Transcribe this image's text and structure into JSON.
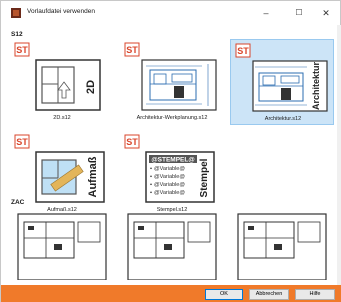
{
  "window": {
    "title": "Vorlaufdatei verwenden",
    "min_label": "–",
    "max_label": "☐",
    "close_label": "✕"
  },
  "groups": [
    {
      "label": "S12",
      "tiles": [
        {
          "label": "2D.s12",
          "badge": "ST",
          "side_text": "2D",
          "selected": false
        },
        {
          "label": "Architektur-Werkplanung.s12",
          "badge": "ST",
          "side_text": "",
          "selected": false
        },
        {
          "label": "Architektur.s12",
          "badge": "ST",
          "side_text": "Architektur",
          "selected": true
        },
        {
          "label": "Aufmaß.s12",
          "badge": "ST",
          "side_text": "Aufmaß",
          "selected": false
        },
        {
          "label": "Stempel.s12",
          "badge": "ST",
          "side_text": "Stempel",
          "selected": false
        }
      ]
    },
    {
      "label": "ZAC",
      "tiles": [
        {
          "label": "",
          "selected": false
        },
        {
          "label": "",
          "selected": false
        },
        {
          "label": "",
          "selected": false
        }
      ]
    }
  ],
  "stempel": {
    "header": "@STEMPEL@",
    "lines": [
      "@Variable@",
      "@Variable@",
      "@Variable@",
      "@Variable@"
    ]
  },
  "footer": {
    "ok_label": "OK",
    "cancel_label": "Abbrechen",
    "help_label": "Hilfe"
  },
  "colors": {
    "badge": "#d9452b",
    "selected_bg": "#cce4f7",
    "footer_bg": "#f07a2a",
    "blueprint_blue": "#2b6cb0"
  }
}
